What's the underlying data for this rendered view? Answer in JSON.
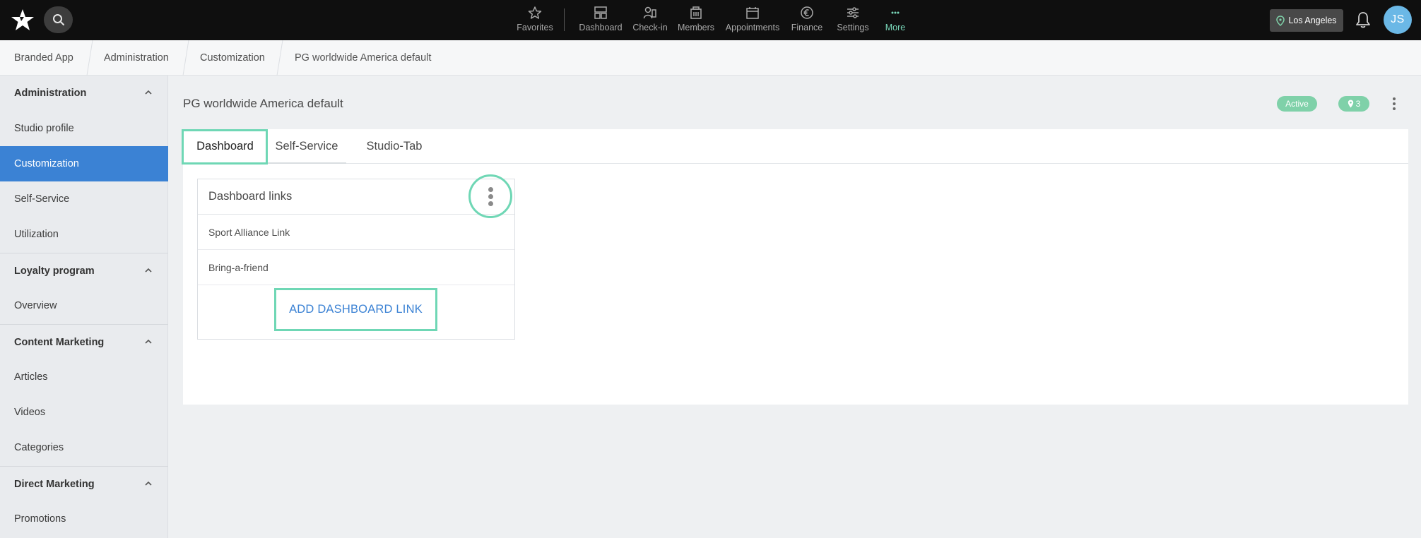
{
  "topbar": {
    "nav": [
      {
        "label": "Favorites",
        "icon": "star-icon"
      },
      {
        "label": "Dashboard",
        "icon": "dashboard-icon"
      },
      {
        "label": "Check-in",
        "icon": "check-in-icon"
      },
      {
        "label": "Members",
        "icon": "members-icon"
      },
      {
        "label": "Appointments",
        "icon": "calendar-icon"
      },
      {
        "label": "Finance",
        "icon": "euro-icon"
      },
      {
        "label": "Settings",
        "icon": "sliders-icon"
      },
      {
        "label": "More",
        "icon": "more-dots-icon"
      }
    ],
    "location": "Los Angeles",
    "avatar_initials": "JS"
  },
  "breadcrumb": [
    "Branded App",
    "Administration",
    "Customization",
    "PG worldwide America default"
  ],
  "sidebar": {
    "sections": [
      {
        "title": "Administration",
        "items": [
          "Studio profile",
          "Customization",
          "Self-Service",
          "Utilization"
        ]
      },
      {
        "title": "Loyalty program",
        "items": [
          "Overview"
        ]
      },
      {
        "title": "Content Marketing",
        "items": [
          "Articles",
          "Videos",
          "Categories"
        ]
      },
      {
        "title": "Direct Marketing",
        "items": [
          "Promotions"
        ]
      }
    ],
    "active_item": "Customization"
  },
  "main": {
    "title": "PG worldwide America default",
    "status_badge": "Active",
    "location_count": "3",
    "tabs": [
      "Dashboard",
      "Self-Service",
      "Studio-Tab"
    ],
    "selected_tab": "Dashboard",
    "card": {
      "title": "Dashboard links",
      "rows": [
        "Sport Alliance Link",
        "Bring-a-friend"
      ],
      "add_button": "ADD DASHBOARD LINK"
    }
  },
  "colors": {
    "topbar_bg": "#0f0f0f",
    "accent_blue": "#3b82d4",
    "highlight_green": "#6fd7b5",
    "badge_green": "#7fd1a9",
    "avatar_blue": "#6bb8e6"
  }
}
